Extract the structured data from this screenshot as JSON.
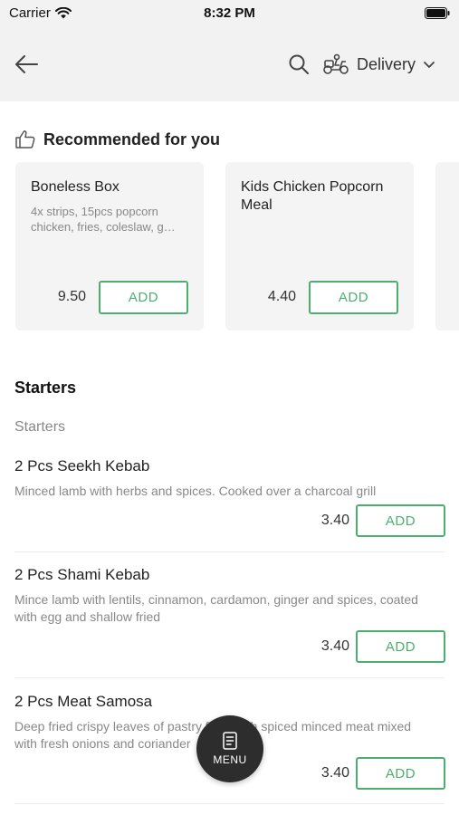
{
  "status_bar": {
    "carrier": "Carrier",
    "time": "8:32 PM"
  },
  "header": {
    "delivery_label": "Delivery"
  },
  "recommended": {
    "title": "Recommended for you",
    "items": [
      {
        "name": "Boneless Box",
        "description": "4x strips, 15pcs popcorn chicken, fries, coleslaw, g…",
        "price": "9.50",
        "add_label": "ADD"
      },
      {
        "name": "Kids Chicken Popcorn Meal",
        "description": "",
        "price": "4.40",
        "add_label": "ADD"
      }
    ]
  },
  "menu": {
    "section_title": "Starters",
    "subsection_title": "Starters",
    "items": [
      {
        "name": "2 Pcs Seekh Kebab",
        "description": "Minced lamb with herbs and spices. Cooked over a charcoal grill",
        "price": "3.40",
        "add_label": "ADD"
      },
      {
        "name": "2 Pcs Shami Kebab",
        "description": "Mince lamb with lentils, cinnamon, cardamon, ginger and spices, coated with egg and shallow fried",
        "price": "3.40",
        "add_label": "ADD"
      },
      {
        "name": "2 Pcs Meat Samosa",
        "description": "Deep fried crispy leaves of pastry filled with spiced minced meat mixed with fresh onions and coriander",
        "price": "3.40",
        "add_label": "ADD"
      }
    ]
  },
  "fab": {
    "label": "MENU",
    "icon": "menu-card-icon"
  },
  "colors": {
    "accent_green": "#4caf70",
    "header_bg": "#f2f2f2",
    "fab_bg": "#2d2d2d"
  }
}
